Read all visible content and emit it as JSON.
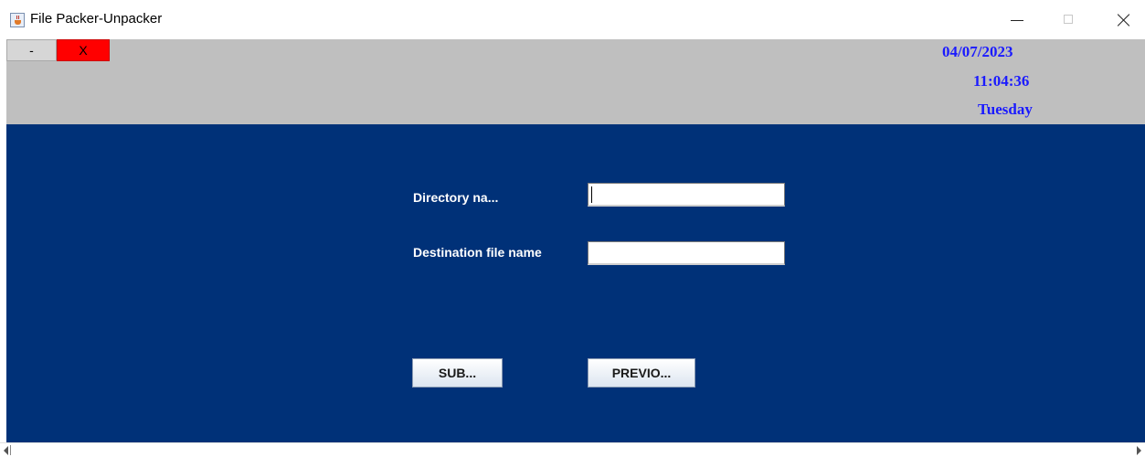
{
  "window": {
    "title": "File Packer-Unpacker"
  },
  "header": {
    "minimize_label": "-",
    "exit_label": "X",
    "date": "04/07/2023",
    "time": "11:04:36",
    "day": "Tuesday"
  },
  "form": {
    "directory_label": "Directory na...",
    "directory_value": "",
    "destination_label": "Destination file name",
    "destination_value": "",
    "submit_label": "SUB...",
    "previous_label": "PREVIO..."
  },
  "colors": {
    "header_background": "#bfbfbf",
    "main_background": "#003178",
    "exit_button": "#ff0000",
    "clock_text": "#1a1aff"
  }
}
